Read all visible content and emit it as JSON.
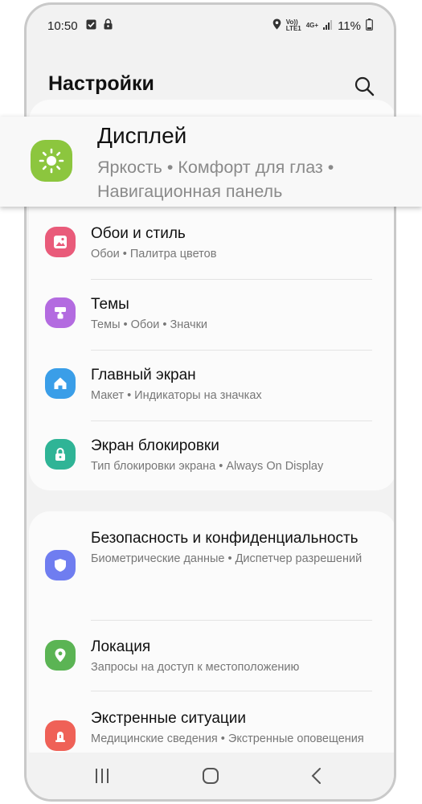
{
  "status_bar": {
    "time": "10:50",
    "volte_label": "Vo))\nLTE1",
    "net_label": "4G+",
    "battery": "11%"
  },
  "header": {
    "title": "Настройки"
  },
  "highlight": {
    "title": "Дисплей",
    "subtitle": "Яркость • Комфорт для глаз • Навигационная панель",
    "color": "#8cc63e"
  },
  "group1": [
    {
      "title": "Обои и стиль",
      "subtitle": "Обои • Палитра цветов",
      "icon": "image-icon",
      "color": "#e95b7a"
    },
    {
      "title": "Темы",
      "subtitle": "Темы • Обои • Значки",
      "icon": "brush-icon",
      "color": "#b36be0"
    },
    {
      "title": "Главный экран",
      "subtitle": "Макет • Индикаторы на значках",
      "icon": "home-icon",
      "color": "#3a9ee8"
    },
    {
      "title": "Экран блокировки",
      "subtitle": "Тип блокировки экрана • Always On Display",
      "icon": "lock-icon",
      "color": "#2fb496"
    }
  ],
  "group2": [
    {
      "title": "Безопасность и конфиденциальность",
      "subtitle": "Биометрические данные • Диспетчер разрешений",
      "icon": "shield-icon",
      "color": "#6f7df0"
    },
    {
      "title": "Локация",
      "subtitle": "Запросы на доступ к местоположению",
      "icon": "location-pin-icon",
      "color": "#5bb454"
    },
    {
      "title": "Экстренные ситуации",
      "subtitle": "Медицинские сведения • Экстренные оповещения",
      "icon": "emergency-icon",
      "color": "#ef6157"
    }
  ]
}
